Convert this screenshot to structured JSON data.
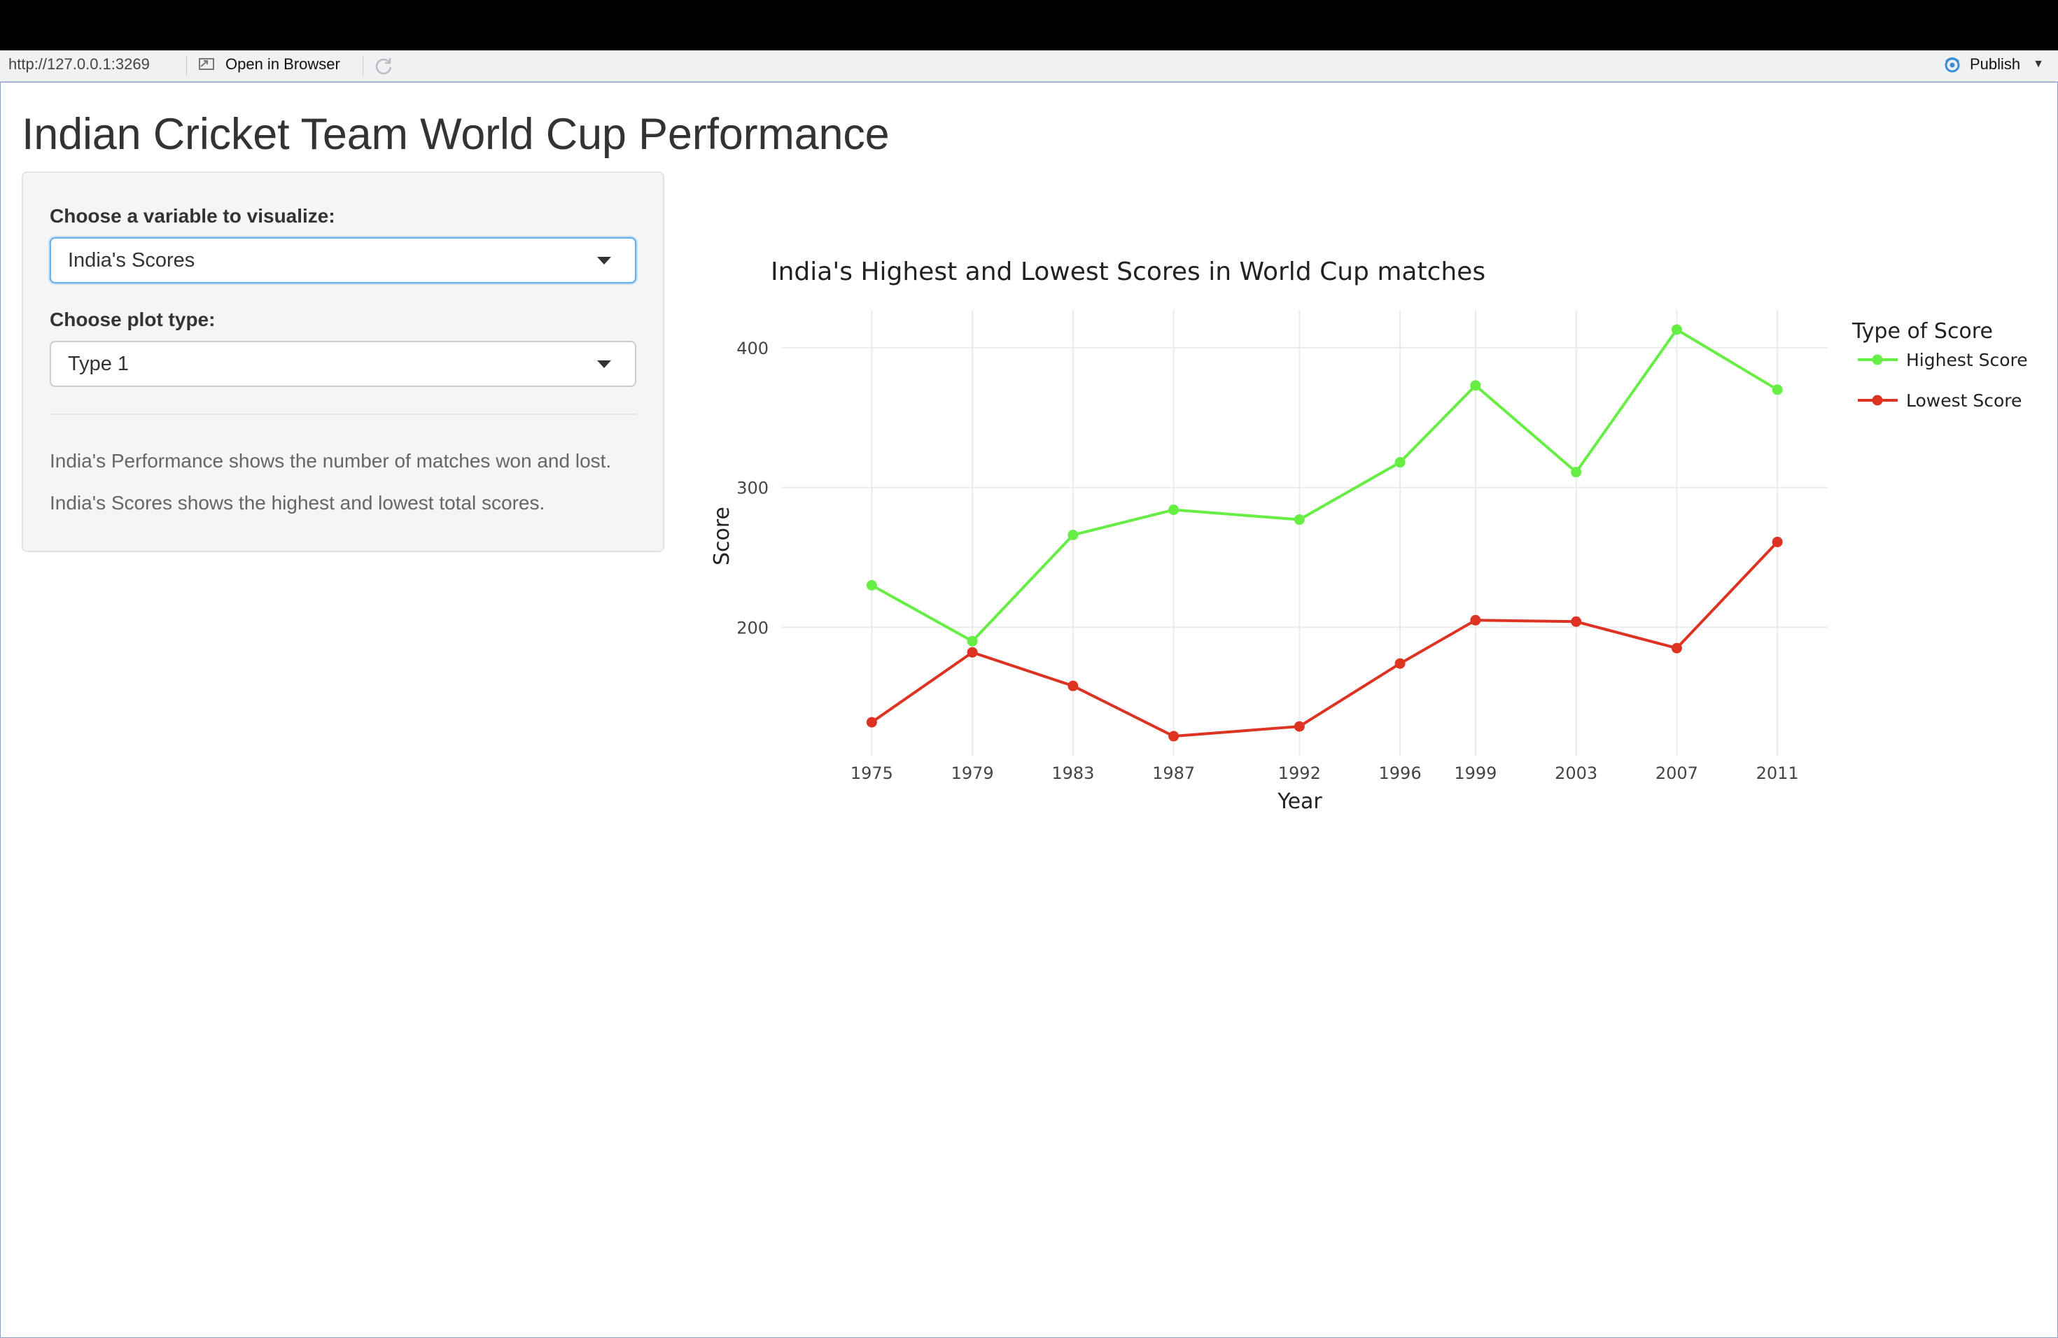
{
  "toolbar": {
    "url": "http://127.0.0.1:3269",
    "open_in_browser": "Open in Browser",
    "publish": "Publish"
  },
  "page": {
    "title": "Indian Cricket Team World Cup Performance"
  },
  "sidebar": {
    "variable_label": "Choose a variable to visualize:",
    "variable_value": "India's Scores",
    "plot_type_label": "Choose plot type:",
    "plot_type_value": "Type 1",
    "help_line_1": "India's Performance shows the number of matches won and lost.",
    "help_line_2": "India's Scores shows the highest and lowest total scores."
  },
  "chart_data": {
    "type": "line",
    "title": "India's Highest and Lowest Scores in World Cup matches",
    "xlabel": "Year",
    "ylabel": "Score",
    "x": [
      1975,
      1979,
      1983,
      1987,
      1992,
      1996,
      1999,
      2003,
      2007,
      2011
    ],
    "xticks": [
      1975,
      1979,
      1983,
      1987,
      1992,
      1996,
      1999,
      2003,
      2007,
      2011
    ],
    "yticks": [
      200,
      300,
      400
    ],
    "xlim": [
      1971.4,
      2013.0
    ],
    "ylim": [
      108,
      427
    ],
    "grid": true,
    "legend_title": "Type of Score",
    "legend_position": "top-right",
    "series": [
      {
        "name": "Highest Score",
        "color": "#66ee44",
        "values": [
          230,
          190,
          266,
          284,
          277,
          318,
          373,
          311,
          413,
          370
        ]
      },
      {
        "name": "Lowest Score",
        "color": "#dd3322",
        "values": [
          132,
          182,
          158,
          122,
          129,
          174,
          205,
          204,
          185,
          261
        ]
      }
    ]
  }
}
